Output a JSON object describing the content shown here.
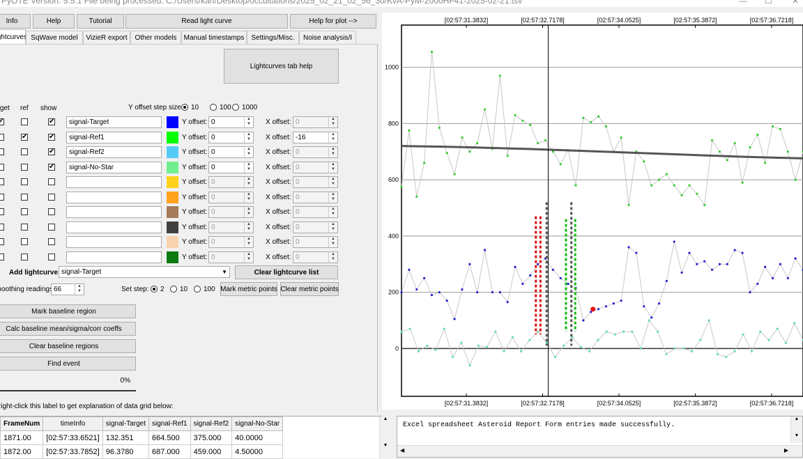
{
  "window": {
    "title": "PyOTE Version: 5.5.1   File being processed: C:/Users/karl/Desktop/occultations/2025_02_21_02_56_30/KvA-PyM-2000HF41-2025-02-21.tsv",
    "minimize": "—",
    "maximize": "☐",
    "close": "✕"
  },
  "toolbar": {
    "info": "Info",
    "help": "Help",
    "tutorial": "Tutorial",
    "read_lightcurve": "Read light curve",
    "help_for_plot": "Help for plot -->"
  },
  "tabs": [
    "Lightcurves",
    "SqWave model",
    "VizieR export",
    "Other models",
    "Manual timestamps",
    "Settings/Misc.",
    "Noise analysis/I"
  ],
  "lightcurves_tab_help": "Lightcurves tab help",
  "columns": {
    "target": "Target",
    "ref": "ref",
    "show": "show"
  },
  "y_offset_step": {
    "label": "Y offset step size:",
    "options": [
      "10",
      "100",
      "1000"
    ],
    "selected": "10"
  },
  "y_offset_label": "Y offset:",
  "x_offset_label": "X offset:",
  "rows": [
    {
      "target": true,
      "ref": false,
      "show": true,
      "name": "signal-Target",
      "color": "#0000ff",
      "y": "0",
      "y_enabled": true,
      "x": "0",
      "x_enabled": false
    },
    {
      "target": false,
      "ref": true,
      "show": true,
      "name": "signal-Ref1",
      "color": "#00ff00",
      "y": "0",
      "y_enabled": true,
      "x": "-16",
      "x_enabled": true
    },
    {
      "target": false,
      "ref": false,
      "show": true,
      "name": "signal-Ref2",
      "color": "#55ccf8",
      "y": "0",
      "y_enabled": true,
      "x": "0",
      "x_enabled": false
    },
    {
      "target": false,
      "ref": false,
      "show": true,
      "name": "signal-No-Star",
      "color": "#6fef8f",
      "y": "0",
      "y_enabled": true,
      "x": "0",
      "x_enabled": false
    },
    {
      "target": false,
      "ref": false,
      "show": false,
      "name": "",
      "color": "#ffd21c",
      "y": "0",
      "y_enabled": false,
      "x": "0",
      "x_enabled": false
    },
    {
      "target": false,
      "ref": false,
      "show": false,
      "name": "",
      "color": "#ffa21c",
      "y": "0",
      "y_enabled": false,
      "x": "0",
      "x_enabled": false
    },
    {
      "target": false,
      "ref": false,
      "show": false,
      "name": "",
      "color": "#a47c5c",
      "y": "0",
      "y_enabled": false,
      "x": "0",
      "x_enabled": false
    },
    {
      "target": false,
      "ref": false,
      "show": false,
      "name": "",
      "color": "#404040",
      "y": "0",
      "y_enabled": false,
      "x": "0",
      "x_enabled": false
    },
    {
      "target": false,
      "ref": false,
      "show": false,
      "name": "",
      "color": "#f8d2ac",
      "y": "0",
      "y_enabled": false,
      "x": "0",
      "x_enabled": false
    },
    {
      "target": false,
      "ref": false,
      "show": false,
      "name": "",
      "color": "#0a7a10",
      "y": "0",
      "y_enabled": false,
      "x": "0",
      "x_enabled": false
    }
  ],
  "add_lightcurve": {
    "label": "Add lightcurve",
    "value": "signal-Target"
  },
  "clear_lightcurve_list": "Clear lightcurve list",
  "smoothing": {
    "label": "Smoothing readings",
    "value": "66"
  },
  "set_step": {
    "label": "Set step:",
    "options": [
      "2",
      "10",
      "100"
    ],
    "selected": "2"
  },
  "mark_metric_points": "Mark metric points",
  "clear_metric_points": "Clear metric points",
  "mark_baseline_region": "Mark baseline region",
  "calc_baseline": "Calc baseline mean/sigma/corr coeffs",
  "clear_baseline_regions": "Clear baseline regions",
  "find_event": "Find event",
  "progress_pct": 0,
  "progress_text": "0%",
  "grid_hint": "Right-click this label to get explanation of data grid below:",
  "grid": {
    "headers": [
      "FrameNum",
      "timeInfo",
      "signal-Target",
      "signal-Ref1",
      "signal-Ref2",
      "signal-No-Star"
    ],
    "rows": [
      [
        "1871.00",
        "[02:57:33.6521]",
        "132.351",
        "664.500",
        "375.000",
        "40.0000"
      ],
      [
        "1872.00",
        "[02:57:33.7852]",
        "96.3780",
        "687.000",
        "459.000",
        "4.50000"
      ]
    ]
  },
  "log_text": "Excel spreadsheet Asteroid Report Form entries made successfully.",
  "chart_data": {
    "type": "line",
    "top_ticks": [
      "[02:57:31.3832]",
      "[02:57:32.7178]",
      "[02:57:34.0525]",
      "[02:57:35.3872]",
      "[02:57:36.7218]"
    ],
    "bottom_ticks": [
      "[02:57:31.3832]",
      "[02:57:32.7178]",
      "[02:57:34.0525]",
      "[02:57:35.3872]",
      "[02:57:36.7218]"
    ],
    "x_range": [
      1852,
      1904
    ],
    "ylim": [
      -170,
      1150
    ],
    "yticks": [
      0,
      200,
      400,
      600,
      800,
      1000
    ],
    "grid": true,
    "cursor_x": 1871,
    "series": [
      {
        "color": "#33cc33",
        "values": [
          575,
          775,
          540,
          660,
          1055,
          785,
          695,
          620,
          750,
          700,
          730,
          850,
          710,
          970,
          685,
          830,
          810,
          795,
          730,
          740,
          700,
          655,
          705,
          580,
          820,
          805,
          825,
          790,
          700,
          750,
          510,
          700,
          665,
          580,
          600,
          620,
          580,
          545,
          580,
          550,
          510,
          740,
          700,
          670,
          730,
          590,
          715,
          760,
          660,
          790,
          780,
          700,
          600,
          700
        ]
      },
      {
        "color": "#2222cc",
        "values": [
          200,
          280,
          210,
          250,
          190,
          200,
          170,
          105,
          210,
          300,
          200,
          350,
          200,
          200,
          165,
          290,
          230,
          260,
          300,
          320,
          280,
          250,
          230,
          215,
          100,
          130,
          140,
          150,
          160,
          170,
          360,
          340,
          150,
          110,
          160,
          240,
          380,
          270,
          340,
          300,
          310,
          280,
          300,
          300,
          350,
          340,
          200,
          230,
          290,
          250,
          300,
          250,
          320,
          280
        ]
      },
      {
        "color": "#66ddaa",
        "values": [
          60,
          70,
          -10,
          10,
          -5,
          70,
          -30,
          20,
          -60,
          10,
          5,
          60,
          -10,
          40,
          -10,
          30,
          60,
          20,
          -30,
          10,
          40,
          5,
          -10,
          30,
          60,
          50,
          60,
          60,
          0,
          100,
          60,
          -20,
          0,
          0,
          -10,
          30,
          100,
          -20,
          -30,
          -10,
          50,
          -10,
          60,
          30,
          70,
          20,
          90,
          30
        ]
      },
      {
        "color": "#555555",
        "smoothed": true,
        "values": [
          720,
          718,
          716,
          713,
          710,
          706,
          702,
          698,
          694,
          690,
          686,
          682,
          679,
          676
        ]
      }
    ],
    "red_markers": [
      {
        "x": 1869.4,
        "from": 50,
        "to": 470
      },
      {
        "x": 1870.0,
        "from": 50,
        "to": 470
      }
    ],
    "green_markers": [
      {
        "x": 1873.3,
        "from": 60,
        "to": 460
      },
      {
        "x": 1874.5,
        "from": 60,
        "to": 460
      }
    ],
    "dark_markers": [
      {
        "x": 1870.8,
        "from": 10,
        "to": 520
      },
      {
        "x": 1874.0,
        "from": 10,
        "to": 520
      }
    ],
    "red_point": {
      "x": 1876.8,
      "y": 140
    }
  }
}
